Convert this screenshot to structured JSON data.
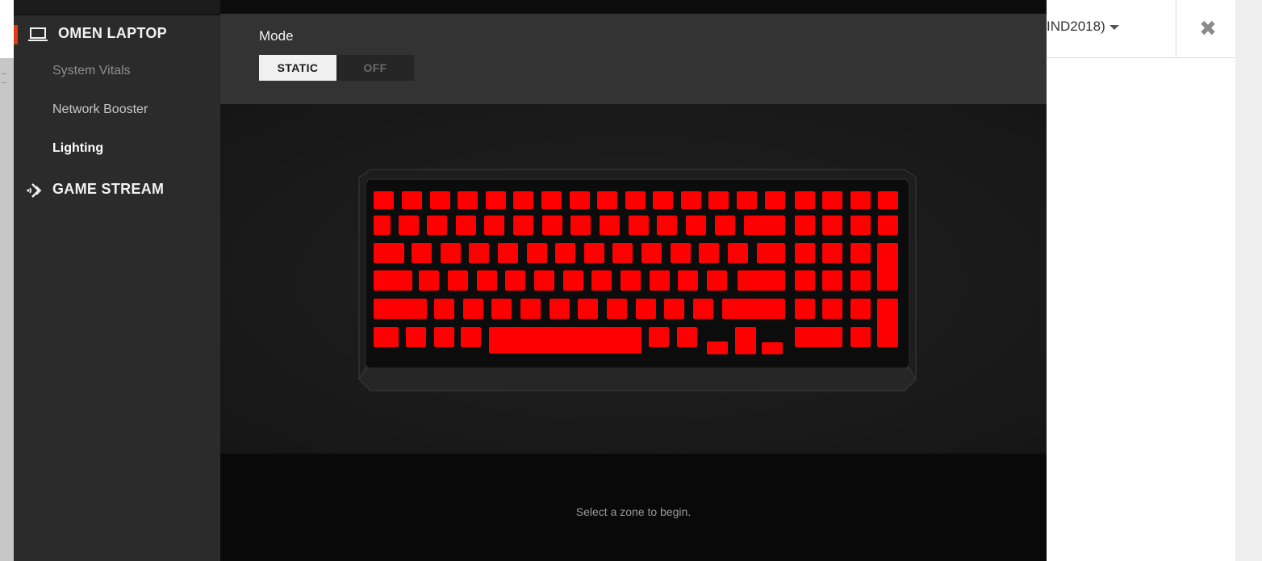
{
  "background_window": {
    "device_select_text": "IND2018)",
    "close_glyph": "✖"
  },
  "sidebar": {
    "device": {
      "label": "OMEN LAPTOP",
      "icon": "laptop-icon"
    },
    "items": [
      {
        "label": "System Vitals",
        "state": "dim"
      },
      {
        "label": "Network Booster",
        "state": "normal"
      },
      {
        "label": "Lighting",
        "state": "selected"
      }
    ],
    "game_stream": {
      "label": "GAME STREAM",
      "icon": "game-stream-icon"
    }
  },
  "mode": {
    "label": "Mode",
    "options": [
      "STATIC",
      "OFF"
    ],
    "selected": "STATIC"
  },
  "keyboard": {
    "key_color": "#ff0000",
    "zones_hint": "red lit keys"
  },
  "status": {
    "message": "Select a zone to begin."
  },
  "colors": {
    "accent": "#e43a10",
    "key": "#ff0000",
    "sidebar_bg": "#2b2b2b",
    "panel_bg": "#333333"
  }
}
